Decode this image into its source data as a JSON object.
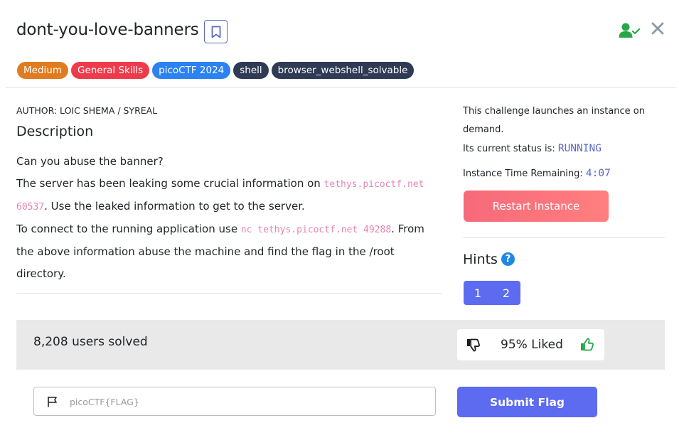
{
  "header": {
    "title": "dont-you-love-banners",
    "bookmark_icon": "bookmark-icon",
    "solved_icon": "user-check-icon",
    "close_icon": "close-icon"
  },
  "tags": [
    {
      "label": "Medium",
      "color": "#e07b1f"
    },
    {
      "label": "General Skills",
      "color": "#ee3b4b"
    },
    {
      "label": "picoCTF 2024",
      "color": "#2b82f0"
    },
    {
      "label": "shell",
      "color": "#2f3a55"
    },
    {
      "label": "browser_webshell_solvable",
      "color": "#2f3a55"
    }
  ],
  "content": {
    "author": "AUTHOR: LOIC SHEMA / SYREAL",
    "description_title": "Description",
    "line1": "Can you abuse the banner?",
    "line2_pre": "The server has been leaking some crucial information on ",
    "line2_code": "tethys.picoctf.net 60537",
    "line2_post": ". Use the leaked information to get to the server.",
    "line3_pre": "To connect to the running application use ",
    "line3_code": "nc tethys.picoctf.net 49288",
    "line3_post": ". From the above information abuse the machine and find the flag in the /root directory."
  },
  "instance": {
    "intro": "This challenge launches an instance on demand.",
    "status_label": "Its current status is: ",
    "status_value": "RUNNING",
    "time_label": "Instance Time Remaining: ",
    "time_value": "4:07",
    "restart_label": "Restart Instance"
  },
  "hints": {
    "title": "Hints",
    "help_glyph": "?",
    "items": [
      "1",
      "2"
    ]
  },
  "stats": {
    "solved": "8,208 users solved",
    "liked": "95% Liked",
    "dislike_icon": "thumbs-down-icon",
    "like_icon": "thumbs-up-icon"
  },
  "flag": {
    "placeholder": "picoCTF{FLAG}",
    "value": "",
    "submit_label": "Submit Flag",
    "flag_icon": "flag-icon"
  },
  "colors": {
    "accent": "#5c6bf0",
    "restart_gradient_start": "#f7697a",
    "restart_gradient_end": "#ff7f7f",
    "status": "#5c6ac4",
    "code": "#e685b5",
    "success": "#28a745"
  }
}
